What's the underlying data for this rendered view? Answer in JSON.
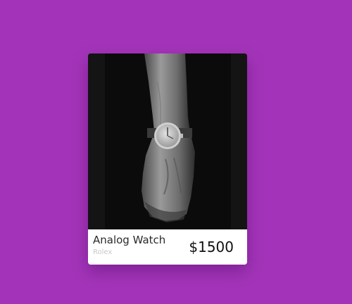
{
  "product": {
    "name": "Analog Watch",
    "brand": "Rolex",
    "price": "$1500",
    "image_icon": "wrist-watch-photo"
  },
  "colors": {
    "background": "#a334b9",
    "card": "#ffffff",
    "image_bg": "#0b0b0b",
    "brand_text": "#c8c8c8"
  }
}
